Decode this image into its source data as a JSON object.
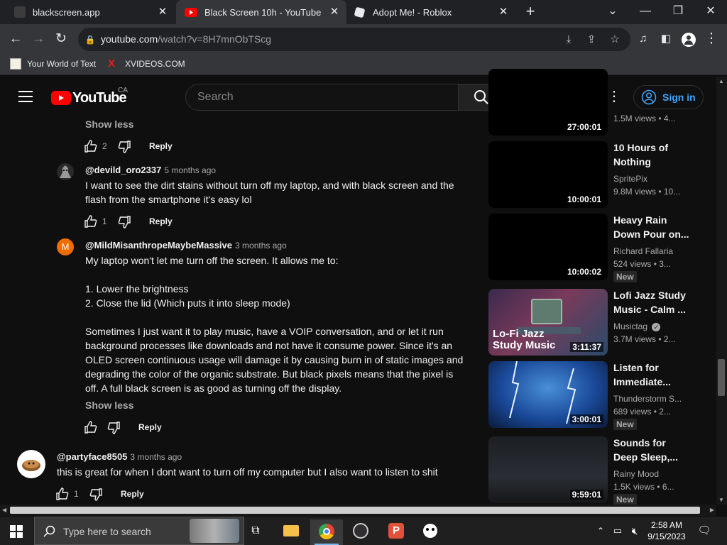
{
  "browser": {
    "tabs": [
      {
        "title": "blackscreen.app"
      },
      {
        "title": "Black Screen 10h - YouTube"
      },
      {
        "title": "Adopt Me! - Roblox"
      }
    ],
    "url_domain": "youtube.com",
    "url_path": "/watch?v=8H7mnObTScg",
    "bookmarks": [
      {
        "label": "Your World of Text"
      },
      {
        "label": "XVIDEOS.COM"
      }
    ]
  },
  "youtube": {
    "logo_text": "YouTube",
    "region": "CA",
    "search_placeholder": "Search",
    "signin_label": "Sign in"
  },
  "comments": [
    {
      "show_less": "Show less",
      "likes": "2",
      "reply": "Reply"
    },
    {
      "handle": "@devild_oro2337",
      "time": "5 months ago",
      "lines": [
        "I want to see the dirt stains without turn off my laptop, and with black screen and the",
        "flash from the smartphone it's easy lol"
      ],
      "likes": "1",
      "reply": "Reply"
    },
    {
      "handle": "@MildMisanthropeMaybeMassive",
      "time": "3 months ago",
      "avatar_letter": "M",
      "lines": [
        "My laptop won't let me turn off the screen. It allows me to:",
        "",
        "1. Lower the brightness",
        "2. Close the lid (Which puts it into sleep mode)",
        "",
        "Sometimes I just want it to play music, have a VOIP conversation, and or let it run",
        "background processes like downloads and not have it consume power. Since it's an",
        "OLED screen continuous usage will damage it by causing burn in of static images and",
        "degrading the color of the organic substrate. But black pixels means that the pixel is",
        "off. A full black screen is as good as turning off the display."
      ],
      "show_less": "Show less",
      "reply": "Reply"
    },
    {
      "handle": "@partyface8505",
      "time": "3 months ago",
      "lines": [
        "this is great for when I dont want to turn off my computer but I also want to listen to shit"
      ],
      "likes": "1",
      "reply": "Reply"
    }
  ],
  "videos": [
    {
      "duration": "27:00:01",
      "meta": "1.5M views • 4..."
    },
    {
      "title": "10 Hours of Nothing",
      "channel": "SpritePix",
      "meta": "9.8M views • 10...",
      "duration": "10:00:01"
    },
    {
      "title": "Heavy Rain Down Pour on...",
      "channel": "Richard Fallaria",
      "meta": "524 views • 3...",
      "badge": "New",
      "duration": "10:00:02"
    },
    {
      "title": "Lofi Jazz Study Music - Calm ...",
      "channel": "Musictag",
      "meta": "3.7M views • 2...",
      "duration": "3:11:37",
      "thumb_text": "Lo-Fi Jazz Study Music"
    },
    {
      "title": "Listen for Immediate...",
      "channel": "Thunderstorm S...",
      "meta": "689 views • 2...",
      "badge": "New",
      "duration": "3:00:01"
    },
    {
      "title": "Sounds for Deep Sleep,...",
      "channel": "Rainy Mood",
      "meta": "1.5K views • 6...",
      "badge": "New",
      "duration": "9:59:01"
    }
  ],
  "taskbar": {
    "search_placeholder": "Type here to search",
    "time": "2:58 AM",
    "date": "9/15/2023"
  },
  "colors": {
    "youtube_red": "#ff0000",
    "link_blue": "#3ea6ff",
    "page_bg": "#0f0f0f",
    "avatar_orange": "#ef6c00"
  },
  "icons": [
    "hamburger-icon",
    "search-icon",
    "mic-icon",
    "more-icon",
    "account-icon",
    "like-icon",
    "dislike-icon",
    "verified-icon",
    "windows-start-icon",
    "chrome-icon",
    "folder-icon"
  ]
}
